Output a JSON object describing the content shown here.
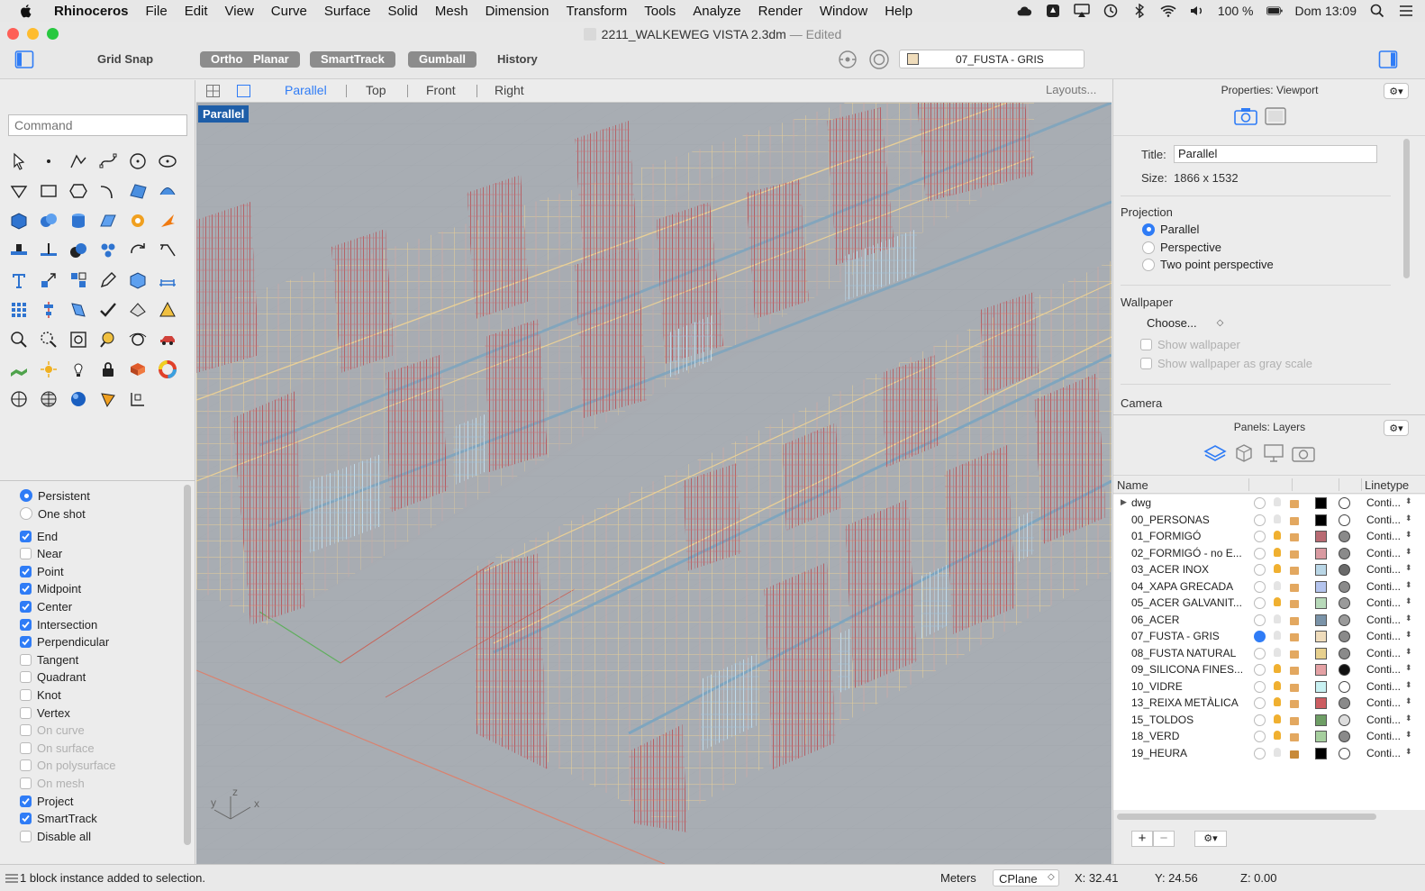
{
  "menubar": {
    "app": "Rhinoceros",
    "items": [
      "File",
      "Edit",
      "View",
      "Curve",
      "Surface",
      "Solid",
      "Mesh",
      "Dimension",
      "Transform",
      "Tools",
      "Analyze",
      "Render",
      "Window",
      "Help"
    ],
    "battery": "100 %",
    "clock": "Dom 13:09"
  },
  "window": {
    "title": "2211_WALKEWEG VISTA 2.3dm",
    "state": "— Edited"
  },
  "toolbar": {
    "grid_snap": "Grid Snap",
    "ortho": "Ortho",
    "planar": "Planar",
    "smarttrack": "SmartTrack",
    "gumball": "Gumball",
    "history": "History",
    "current_layer": "07_FUSTA - GRIS"
  },
  "command": {
    "placeholder": "Command"
  },
  "viewport_tabs": {
    "parallel": "Parallel",
    "top": "Top",
    "front": "Front",
    "right": "Right",
    "layouts": "Layouts..."
  },
  "viewport": {
    "label": "Parallel",
    "axis_y": "y",
    "axis_z": "z",
    "axis_x": "x"
  },
  "osnap": {
    "persistent": "Persistent",
    "oneshot": "One shot",
    "items": [
      {
        "label": "End",
        "on": true
      },
      {
        "label": "Near",
        "on": false
      },
      {
        "label": "Point",
        "on": true
      },
      {
        "label": "Midpoint",
        "on": true
      },
      {
        "label": "Center",
        "on": true
      },
      {
        "label": "Intersection",
        "on": true
      },
      {
        "label": "Perpendicular",
        "on": true
      },
      {
        "label": "Tangent",
        "on": false
      },
      {
        "label": "Quadrant",
        "on": false
      },
      {
        "label": "Knot",
        "on": false
      },
      {
        "label": "Vertex",
        "on": false
      },
      {
        "label": "On curve",
        "on": false
      },
      {
        "label": "On surface",
        "on": false
      },
      {
        "label": "On polysurface",
        "on": false
      },
      {
        "label": "On mesh",
        "on": false
      },
      {
        "label": "Project",
        "on": true
      },
      {
        "label": "SmartTrack",
        "on": true
      },
      {
        "label": "Disable all",
        "on": false
      }
    ]
  },
  "properties": {
    "title": "Properties: Viewport",
    "title_label": "Title:",
    "title_value": "Parallel",
    "size_label": "Size:",
    "size_value": "1866 x 1532",
    "projection": "Projection",
    "proj_parallel": "Parallel",
    "proj_perspective": "Perspective",
    "proj_two_point": "Two point perspective",
    "wallpaper": "Wallpaper",
    "choose": "Choose...",
    "show_wallpaper": "Show wallpaper",
    "show_gray": "Show wallpaper as gray scale",
    "camera": "Camera"
  },
  "layers": {
    "title": "Panels: Layers",
    "col_name": "Name",
    "col_linetype": "Linetype",
    "rows": [
      {
        "name": "dwg",
        "color": "#000000",
        "mat": "#ffffff",
        "linetype": "Conti...",
        "expand": true
      },
      {
        "name": "00_PERSONAS",
        "color": "#000000",
        "mat": "#ffffff",
        "linetype": "Conti..."
      },
      {
        "name": "01_FORMIGÓ",
        "color": "#b86a72",
        "mat": "#8a8a8a",
        "linetype": "Conti..."
      },
      {
        "name": "02_FORMIGÓ - no E...",
        "color": "#d99aa1",
        "mat": "#8a8a8a",
        "linetype": "Conti..."
      },
      {
        "name": "03_ACER INOX",
        "color": "#b9d6e6",
        "mat": "#6a6a6a",
        "linetype": "Conti..."
      },
      {
        "name": "04_XAPA GRECADA",
        "color": "#b4c4ee",
        "mat": "#8a8a8a",
        "linetype": "Conti..."
      },
      {
        "name": "05_ACER GALVANIT...",
        "color": "#b7d9b9",
        "mat": "#9a9a9a",
        "linetype": "Conti..."
      },
      {
        "name": "06_ACER",
        "color": "#7a93a8",
        "mat": "#9a9a9a",
        "linetype": "Conti..."
      },
      {
        "name": "07_FUSTA - GRIS",
        "color": "#efdcbb",
        "mat": "#8a8a8a",
        "linetype": "Conti...",
        "current": true
      },
      {
        "name": "08_FUSTA NATURAL",
        "color": "#e7d08e",
        "mat": "#8a8a8a",
        "linetype": "Conti..."
      },
      {
        "name": "09_SILICONA FINES...",
        "color": "#e4a1a4",
        "mat": "#111111",
        "linetype": "Conti..."
      },
      {
        "name": "10_VIDRE",
        "color": "#c8f1f2",
        "mat": "#ffffff",
        "linetype": "Conti..."
      },
      {
        "name": "13_REIXA METÀLICA",
        "color": "#cc5d61",
        "mat": "#8a8a8a",
        "linetype": "Conti..."
      },
      {
        "name": "15_TOLDOS",
        "color": "#6e9e65",
        "mat": "#dddddd",
        "linetype": "Conti..."
      },
      {
        "name": "18_VERD",
        "color": "#a6cf9e",
        "mat": "#8a8a8a",
        "linetype": "Conti..."
      },
      {
        "name": "19_HEURA",
        "color": "#000000",
        "mat": "#ffffff",
        "linetype": "Conti..."
      }
    ]
  },
  "status": {
    "message": "1 block instance added to selection.",
    "units": "Meters",
    "cplane": "CPlane",
    "x": "X: 32.41",
    "y": "Y: 24.56",
    "z": "Z: 0.00"
  }
}
